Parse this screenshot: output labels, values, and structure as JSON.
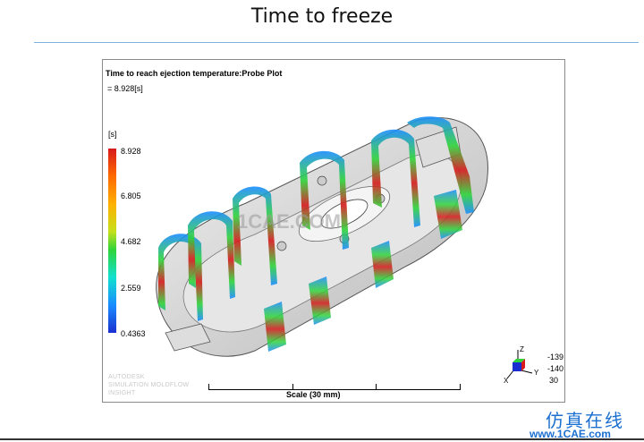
{
  "slide": {
    "title": "Time to freeze"
  },
  "plot": {
    "title": "Time to reach ejection temperature:Probe Plot",
    "probe_value": "= 8.928[s]",
    "units": "[s]",
    "ticks": [
      "8.928",
      "6.805",
      "4.682",
      "2.559",
      "0.4363"
    ],
    "watermark": [
      "AUTODESK",
      "SIMULATION MOLDFLOW",
      "INSIGHT"
    ],
    "scale_label": "Scale (30 mm)",
    "rotation": [
      "-139",
      "-140",
      "30"
    ],
    "axes": {
      "z": "Z",
      "y": "Y",
      "x": "X"
    },
    "center_watermark": "1CAE.COM"
  },
  "logo": {
    "cn": "仿真在线",
    "url": "www.1CAE.com"
  },
  "colors": {
    "accent_line": "#7db3e0",
    "logo_blue": "#1a6fd0"
  }
}
